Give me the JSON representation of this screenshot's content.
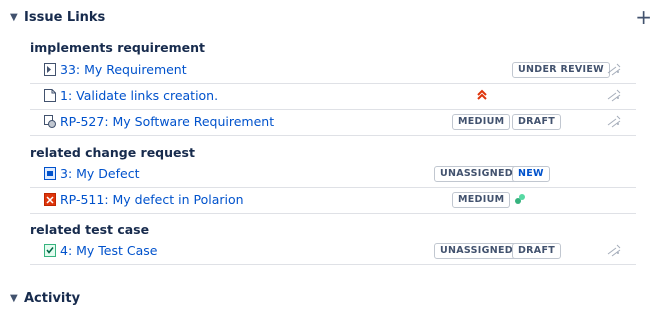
{
  "issue_links": {
    "title": "Issue Links",
    "add_icon": "plus-icon",
    "groups": [
      {
        "label": "implements requirement",
        "items": [
          {
            "title": "33: My Requirement",
            "icon": "requirement-icon",
            "status": "UNDER REVIEW"
          },
          {
            "title": "1: Validate links creation.",
            "icon": "document-icon",
            "priority_icon": "priority-highest-icon"
          },
          {
            "title": "RP-527: My Software Requirement",
            "icon": "software-requirement-icon",
            "priority": "MEDIUM",
            "status": "DRAFT"
          }
        ]
      },
      {
        "label": "related change request",
        "items": [
          {
            "title": "3: My Defect",
            "icon": "defect-icon",
            "priority": "UNASSIGNED",
            "status": "NEW"
          },
          {
            "title": "RP-511: My defect in Polarion",
            "icon": "polarion-defect-icon",
            "priority": "MEDIUM",
            "status_icon": "green-status-icon"
          }
        ]
      },
      {
        "label": "related test case",
        "items": [
          {
            "title": "4: My Test Case",
            "icon": "test-case-icon",
            "priority": "UNASSIGNED",
            "status": "DRAFT"
          }
        ]
      }
    ]
  },
  "activity": {
    "title": "Activity"
  },
  "colors": {
    "link": "#0052cc",
    "divider": "#dfe1e6",
    "priority_high": "#de350b",
    "status_green": "#36b37e"
  }
}
